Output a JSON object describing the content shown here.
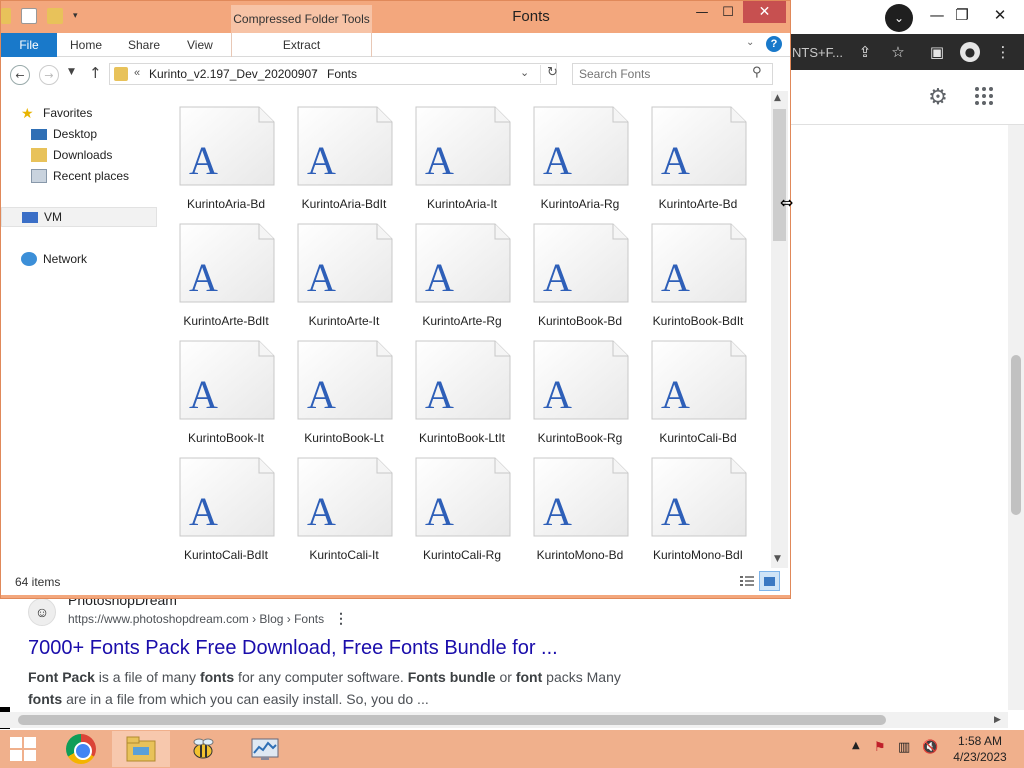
{
  "chrome": {
    "tab_text": "NTS+F...",
    "ctl_minimize": "—",
    "ctl_restore": "❐",
    "ctl_close": "✕",
    "dropdown_icon": "⌄",
    "toolbar_icons": [
      "share-icon",
      "star-icon",
      "sidebar-icon",
      "profile-icon",
      "menu-icon"
    ],
    "result": {
      "site_name": "PhotoshopDream",
      "url": "https://www.photoshopdream.com › Blog › Fonts",
      "title": "7000+ Fonts Pack Free Download, Free Fonts Bundle for ...",
      "snippet_parts": [
        {
          "bold": true,
          "text": "Font Pack"
        },
        {
          "bold": false,
          "text": " is a file of many "
        },
        {
          "bold": true,
          "text": "fonts"
        },
        {
          "bold": false,
          "text": " for any computer software. "
        },
        {
          "bold": true,
          "text": "Fonts bundle"
        },
        {
          "bold": false,
          "text": " or "
        },
        {
          "bold": true,
          "text": "font"
        },
        {
          "bold": false,
          "text": " packs Many "
        },
        {
          "bold": true,
          "text": "fonts"
        },
        {
          "bold": false,
          "text": " are in a file from which you can easily install. So, you do ..."
        }
      ]
    }
  },
  "explorer": {
    "title": "Fonts",
    "context_tab": "Compressed Folder Tools",
    "ribbon_tabs": {
      "file": "File",
      "home": "Home",
      "share": "Share",
      "view": "View",
      "extract": "Extract"
    },
    "help": "?",
    "address": {
      "overflow": "«",
      "crumb1": "Kurinto_v2.197_Dev_20200907",
      "separator": "›",
      "crumb2": "Fonts"
    },
    "search_placeholder": "Search Fonts",
    "nav": {
      "favorites": "Favorites",
      "desktop": "Desktop",
      "downloads": "Downloads",
      "recent_places": "Recent places",
      "vm": "VM",
      "network": "Network"
    },
    "files": [
      "KurintoAria-Bd",
      "KurintoAria-BdIt",
      "KurintoAria-It",
      "KurintoAria-Rg",
      "KurintoArte-Bd",
      "KurintoArte-BdIt",
      "KurintoArte-It",
      "KurintoArte-Rg",
      "KurintoBook-Bd",
      "KurintoBook-BdIt",
      "KurintoBook-It",
      "KurintoBook-Lt",
      "KurintoBook-LtIt",
      "KurintoBook-Rg",
      "KurintoCali-Bd",
      "KurintoCali-BdIt",
      "KurintoCali-It",
      "KurintoCali-Rg",
      "KurintoMono-Bd",
      "KurintoMono-BdI"
    ],
    "file_glyph": "A",
    "status": "64 items"
  },
  "taskbar": {
    "clock_time": "1:58 AM",
    "clock_date": "4/23/2023"
  },
  "colors": {
    "window_frame": "#f3a77d",
    "ribbon_file": "#1979ca",
    "link": "#1a0dab"
  }
}
